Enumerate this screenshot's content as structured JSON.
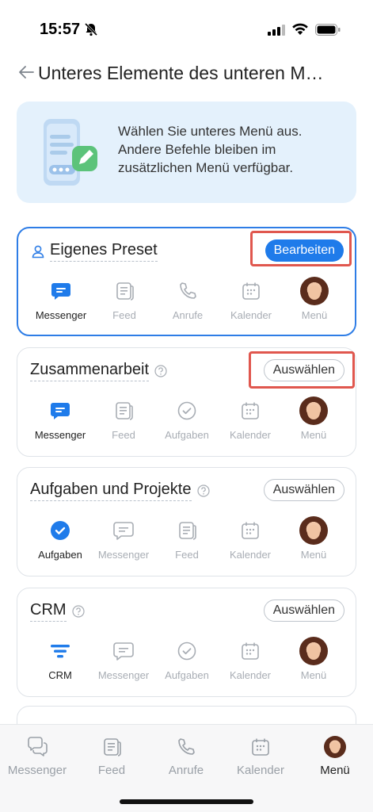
{
  "status_bar": {
    "time": "15:57",
    "icons": [
      "bell-slash-icon",
      "signal-icon",
      "wifi-icon",
      "battery-icon"
    ]
  },
  "header": {
    "title": "Unteres Elemente des unteren M…",
    "back_icon": "back-arrow-icon"
  },
  "banner": {
    "text": "Wählen Sie unteres Menü aus. Andere Befehle bleiben im zusätzlichen Menü verfügbar.",
    "illustration": "phone-edit-illustration"
  },
  "presets": [
    {
      "title": "Eigenes Preset",
      "button": "Bearbeiten",
      "selected": true,
      "highlighted": true,
      "items": [
        {
          "label": "Messenger",
          "icon": "chat-icon",
          "active": true
        },
        {
          "label": "Feed",
          "icon": "feed-icon",
          "active": false
        },
        {
          "label": "Anrufe",
          "icon": "phone-icon",
          "active": false
        },
        {
          "label": "Kalender",
          "icon": "calendar-icon",
          "active": false
        },
        {
          "label": "Menü",
          "icon": "avatar",
          "active": false
        }
      ]
    },
    {
      "title": "Zusammenarbeit",
      "button": "Auswählen",
      "selected": false,
      "highlighted": true,
      "items": [
        {
          "label": "Messenger",
          "icon": "chat-icon",
          "active": true
        },
        {
          "label": "Feed",
          "icon": "feed-icon",
          "active": false
        },
        {
          "label": "Aufgaben",
          "icon": "check-circle-icon",
          "active": false
        },
        {
          "label": "Kalender",
          "icon": "calendar-icon",
          "active": false
        },
        {
          "label": "Menü",
          "icon": "avatar",
          "active": false
        }
      ]
    },
    {
      "title": "Aufgaben und Projekte",
      "button": "Auswählen",
      "selected": false,
      "highlighted": false,
      "items": [
        {
          "label": "Aufgaben",
          "icon": "check-circle-icon",
          "active": true
        },
        {
          "label": "Messenger",
          "icon": "chat-icon",
          "active": false
        },
        {
          "label": "Feed",
          "icon": "feed-icon",
          "active": false
        },
        {
          "label": "Kalender",
          "icon": "calendar-icon",
          "active": false
        },
        {
          "label": "Menü",
          "icon": "avatar",
          "active": false
        }
      ]
    },
    {
      "title": "CRM",
      "button": "Auswählen",
      "selected": false,
      "highlighted": false,
      "items": [
        {
          "label": "CRM",
          "icon": "funnel-icon",
          "active": true
        },
        {
          "label": "Messenger",
          "icon": "chat-icon",
          "active": false
        },
        {
          "label": "Aufgaben",
          "icon": "check-circle-icon",
          "active": false
        },
        {
          "label": "Kalender",
          "icon": "calendar-icon",
          "active": false
        },
        {
          "label": "Menü",
          "icon": "avatar",
          "active": false
        }
      ]
    }
  ],
  "tab_bar": [
    {
      "label": "Messenger",
      "icon": "chat-icon",
      "active": false
    },
    {
      "label": "Feed",
      "icon": "feed-icon",
      "active": false
    },
    {
      "label": "Anrufe",
      "icon": "phone-icon",
      "active": false
    },
    {
      "label": "Kalender",
      "icon": "calendar-icon",
      "active": false
    },
    {
      "label": "Menü",
      "icon": "avatar",
      "active": true
    }
  ],
  "colors": {
    "accent": "#1f7bea",
    "highlight": "#e0574e",
    "banner_bg": "#e4f1fc",
    "inactive": "#a8adb4"
  }
}
